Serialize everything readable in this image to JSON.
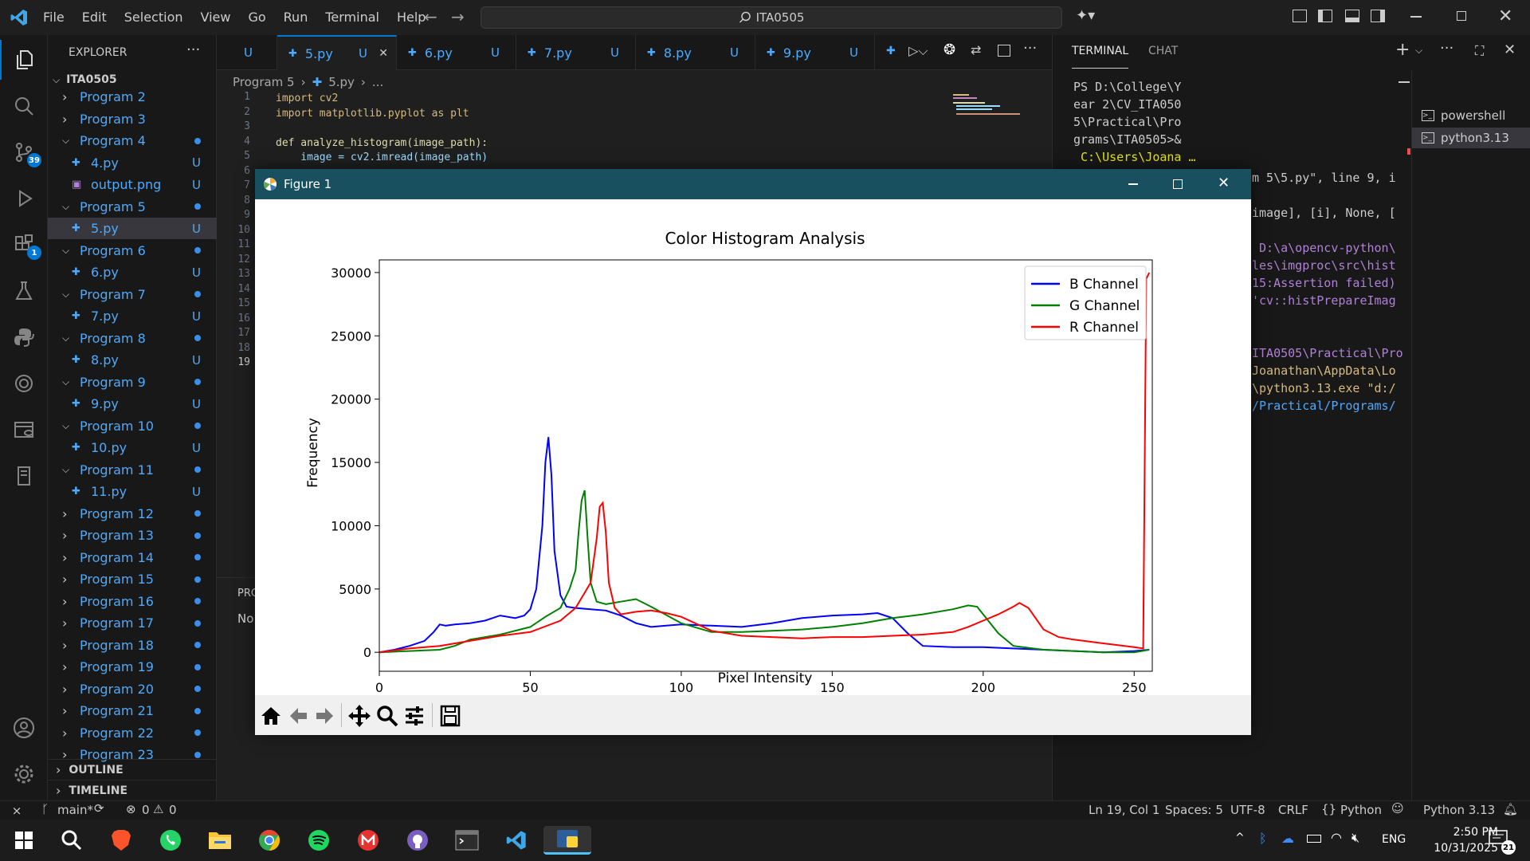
{
  "menu": [
    "File",
    "Edit",
    "Selection",
    "View",
    "Go",
    "Run",
    "Terminal",
    "Help"
  ],
  "search": "ITA0505",
  "activity_badges": {
    "source_control": "39",
    "extensions": "1"
  },
  "explorer": {
    "header": "EXPLORER",
    "root": "ITA0505",
    "items": [
      {
        "label": "Program 2",
        "kind": "folder-closed",
        "mark": ""
      },
      {
        "label": "Program 3",
        "kind": "folder-closed",
        "mark": ""
      },
      {
        "label": "Program 4",
        "kind": "folder-open",
        "mark": "dot"
      },
      {
        "label": "4.py",
        "kind": "file-py",
        "mark": "U"
      },
      {
        "label": "output.png",
        "kind": "file-img",
        "mark": "U"
      },
      {
        "label": "Program 5",
        "kind": "folder-open",
        "mark": "dot"
      },
      {
        "label": "5.py",
        "kind": "file-py",
        "mark": "U"
      },
      {
        "label": "Program 6",
        "kind": "folder-open",
        "mark": "dot"
      },
      {
        "label": "6.py",
        "kind": "file-py",
        "mark": "U"
      },
      {
        "label": "Program 7",
        "kind": "folder-open",
        "mark": "dot"
      },
      {
        "label": "7.py",
        "kind": "file-py",
        "mark": "U"
      },
      {
        "label": "Program 8",
        "kind": "folder-open",
        "mark": "dot"
      },
      {
        "label": "8.py",
        "kind": "file-py",
        "mark": "U"
      },
      {
        "label": "Program 9",
        "kind": "folder-open",
        "mark": "dot"
      },
      {
        "label": "9.py",
        "kind": "file-py",
        "mark": "U"
      },
      {
        "label": "Program 10",
        "kind": "folder-open",
        "mark": "dot"
      },
      {
        "label": "10.py",
        "kind": "file-py",
        "mark": "U"
      },
      {
        "label": "Program 11",
        "kind": "folder-open",
        "mark": "dot"
      },
      {
        "label": "11.py",
        "kind": "file-py",
        "mark": "U"
      },
      {
        "label": "Program 12",
        "kind": "folder-closed",
        "mark": "dot"
      },
      {
        "label": "Program 13",
        "kind": "folder-closed",
        "mark": "dot"
      },
      {
        "label": "Program 14",
        "kind": "folder-closed",
        "mark": "dot"
      },
      {
        "label": "Program 15",
        "kind": "folder-closed",
        "mark": "dot"
      },
      {
        "label": "Program 16",
        "kind": "folder-closed",
        "mark": "dot"
      },
      {
        "label": "Program 17",
        "kind": "folder-closed",
        "mark": "dot"
      },
      {
        "label": "Program 18",
        "kind": "folder-closed",
        "mark": "dot"
      },
      {
        "label": "Program 19",
        "kind": "folder-closed",
        "mark": "dot"
      },
      {
        "label": "Program 20",
        "kind": "folder-closed",
        "mark": "dot"
      },
      {
        "label": "Program 21",
        "kind": "folder-closed",
        "mark": "dot"
      },
      {
        "label": "Program 22",
        "kind": "folder-closed",
        "mark": "dot"
      },
      {
        "label": "Program 23",
        "kind": "folder-closed",
        "mark": "dot"
      }
    ],
    "outline": "OUTLINE",
    "timeline": "TIMELINE"
  },
  "tabs": [
    {
      "label": "",
      "mark": "U",
      "active": false
    },
    {
      "label": "5.py",
      "mark": "U",
      "active": true
    },
    {
      "label": "6.py",
      "mark": "U",
      "active": false
    },
    {
      "label": "7.py",
      "mark": "U",
      "active": false
    },
    {
      "label": "8.py",
      "mark": "U",
      "active": false
    },
    {
      "label": "9.py",
      "mark": "U",
      "active": false
    }
  ],
  "breadcrumb": [
    "Program 5",
    "5.py",
    "..."
  ],
  "code_lines": [
    {
      "n": "1",
      "text": "import cv2"
    },
    {
      "n": "2",
      "text": "import matplotlib.pyplot as plt"
    },
    {
      "n": "3",
      "text": ""
    },
    {
      "n": "4",
      "text": "def analyze_histogram(image_path):"
    },
    {
      "n": "5",
      "text": "    image = cv2.imread(image_path)"
    }
  ],
  "more_line_numbers": [
    "6",
    "7",
    "8",
    "9",
    "10",
    "11",
    "12",
    "13",
    "14",
    "15",
    "16",
    "17",
    "18",
    "19"
  ],
  "problems_tab": "PRO",
  "problems_text": "No",
  "panel": {
    "tabs": [
      "TERMINAL",
      "CHAT"
    ],
    "terminals": [
      "powershell",
      "python3.13"
    ],
    "lines_white": [
      "PS D:\\College\\Y",
      "ear 2\\CV_ITA050",
      "5\\Practical\\Pro",
      "grams\\ITA0505>&"
    ],
    "line_yellow": " C:\\Users\\Joana …",
    "right_lines": [
      {
        "text": "m 5\\5.py\", line 9, i",
        "color": "#cccccc"
      },
      {
        "text": "image], [i], None, [",
        "color": "#cccccc"
      },
      {
        "text": " D:\\a\\opencv-python\\",
        "color": "#b180d7"
      },
      {
        "text": "les\\imgproc\\src\\hist",
        "color": "#b180d7"
      },
      {
        "text": "15:Assertion failed)",
        "color": "#b180d7"
      },
      {
        "text": "'cv::histPrepareImag",
        "color": "#b180d7"
      },
      {
        "text": "ITA0505\\Practical\\Pro",
        "color": "#b180d7"
      },
      {
        "text": "Joanathan\\AppData\\Lo",
        "color": "#d7ba7d"
      },
      {
        "text": "\\python3.13.exe \"d:/",
        "color": "#d7ba7d"
      },
      {
        "text": "/Practical/Programs/",
        "color": "#4daafc"
      }
    ]
  },
  "statusbar": {
    "branch": "main*",
    "errors": "0",
    "warnings": "0",
    "position": "Ln 19, Col 1",
    "spaces": "Spaces: 5",
    "encoding": "UTF-8",
    "eol": "CRLF",
    "language": "Python",
    "interpreter": "Python 3.13"
  },
  "taskbar": {
    "lang": "ENG",
    "time": "2:50 PM",
    "date": "10/31/2025",
    "notif": "21"
  },
  "figure": {
    "window_title": "Figure 1"
  },
  "chart_data": {
    "type": "line",
    "title": "Color Histogram Analysis",
    "xlabel": "Pixel Intensity",
    "ylabel": "Frequency",
    "xlim": [
      0,
      256
    ],
    "ylim": [
      -1500,
      31000
    ],
    "xticks": [
      0,
      50,
      100,
      150,
      200,
      250
    ],
    "yticks": [
      0,
      5000,
      10000,
      15000,
      20000,
      25000,
      30000
    ],
    "legend_position": "top-right",
    "series": [
      {
        "name": "B Channel",
        "color": "#0000ff",
        "x": [
          0,
          5,
          10,
          15,
          18,
          20,
          22,
          25,
          30,
          35,
          40,
          45,
          48,
          50,
          52,
          54,
          55,
          56,
          57,
          58,
          60,
          62,
          65,
          70,
          75,
          80,
          85,
          90,
          95,
          100,
          110,
          120,
          130,
          140,
          150,
          160,
          165,
          170,
          175,
          180,
          190,
          200,
          210,
          220,
          230,
          240,
          250,
          255
        ],
        "y": [
          0,
          200,
          500,
          900,
          1600,
          2200,
          2100,
          2200,
          2300,
          2500,
          2900,
          2700,
          2900,
          3400,
          5000,
          10000,
          15000,
          17000,
          14000,
          8000,
          4500,
          3600,
          3500,
          3400,
          3300,
          2900,
          2300,
          2000,
          2100,
          2200,
          2100,
          2000,
          2300,
          2700,
          2900,
          3000,
          3100,
          2700,
          1500,
          500,
          400,
          400,
          300,
          200,
          100,
          0,
          100,
          200
        ]
      },
      {
        "name": "G Channel",
        "color": "#008000",
        "x": [
          0,
          10,
          20,
          25,
          30,
          40,
          50,
          55,
          60,
          62,
          63,
          65,
          66,
          67,
          68,
          69,
          70,
          72,
          75,
          80,
          85,
          90,
          100,
          110,
          120,
          130,
          140,
          150,
          160,
          170,
          180,
          190,
          195,
          198,
          200,
          205,
          210,
          220,
          230,
          240,
          250,
          255
        ],
        "y": [
          0,
          100,
          200,
          500,
          1000,
          1400,
          2000,
          2800,
          3500,
          4500,
          5000,
          6500,
          9500,
          12000,
          12800,
          9000,
          5500,
          4000,
          3800,
          4000,
          4200,
          3600,
          2300,
          1600,
          1600,
          1700,
          1800,
          2000,
          2300,
          2700,
          3000,
          3400,
          3700,
          3600,
          3000,
          1500,
          500,
          200,
          100,
          0,
          0,
          200
        ]
      },
      {
        "name": "R Channel",
        "color": "#ff0000",
        "x": [
          0,
          10,
          20,
          30,
          40,
          50,
          60,
          65,
          70,
          72,
          73,
          74,
          75,
          76,
          78,
          80,
          85,
          90,
          95,
          100,
          110,
          120,
          130,
          140,
          150,
          160,
          170,
          180,
          190,
          195,
          200,
          205,
          210,
          212,
          215,
          220,
          225,
          230,
          240,
          250,
          253,
          254,
          255
        ],
        "y": [
          0,
          300,
          500,
          900,
          1300,
          1600,
          2500,
          3500,
          5500,
          9000,
          11500,
          11800,
          9500,
          5500,
          3500,
          3000,
          3200,
          3300,
          3100,
          2800,
          1700,
          1300,
          1200,
          1100,
          1200,
          1200,
          1300,
          1400,
          1600,
          2000,
          2500,
          3000,
          3600,
          3900,
          3500,
          1800,
          1200,
          1000,
          700,
          400,
          300,
          29500,
          30000
        ]
      }
    ]
  }
}
